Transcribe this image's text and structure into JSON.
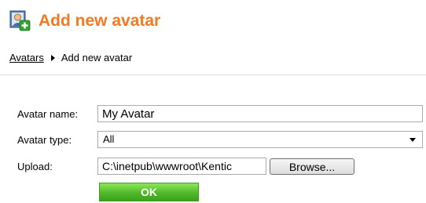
{
  "header": {
    "title": "Add new avatar",
    "icon": "avatar-add-icon"
  },
  "breadcrumb": {
    "parent": "Avatars",
    "current": "Add new avatar",
    "separator_icon": "triangle-right-icon"
  },
  "form": {
    "name_label": "Avatar name:",
    "name_value": "My Avatar",
    "type_label": "Avatar type:",
    "type_value": "All",
    "upload_label": "Upload:",
    "upload_value": "C:\\inetpub\\wwwroot\\Kentic",
    "browse_label": "Browse...",
    "ok_label": "OK"
  },
  "colors": {
    "title": "#f47920",
    "ok_button": "#4fb92a"
  }
}
